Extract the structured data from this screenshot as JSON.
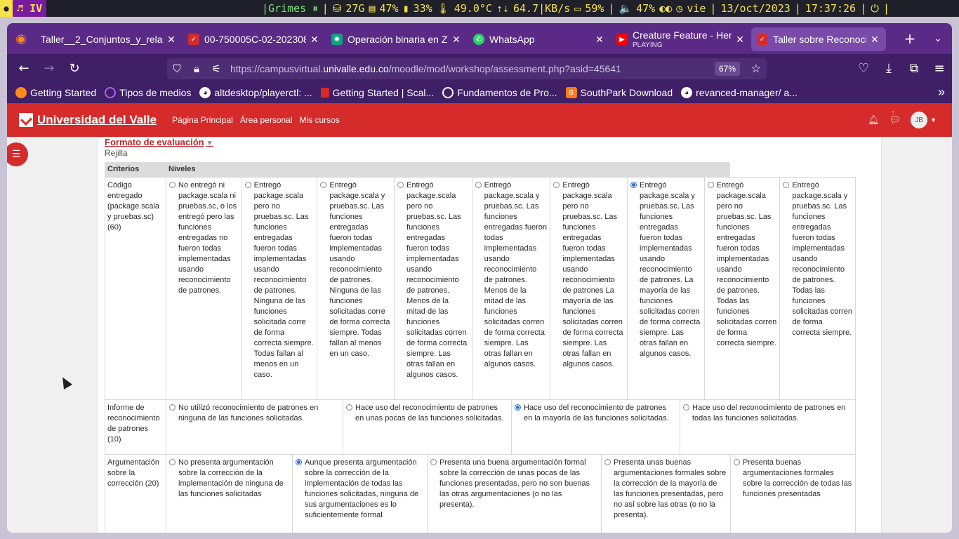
{
  "sysbar": {
    "workspace": "IV",
    "music": "|Grimes ⏸",
    "disk": "27G",
    "mem": "47%",
    "cpu": "33%",
    "temp": "49.0°C",
    "net": "64.7|KB/s",
    "battery": "59%",
    "volume": "47%",
    "day": "vie",
    "date": "13/oct/2023",
    "time": "17:37:26"
  },
  "tabs": [
    {
      "label": "Taller__2_Conjuntos_y_rela",
      "color": "#5b2a86"
    },
    {
      "label": "00-750005C-02-202308",
      "color": "#d52b2b"
    },
    {
      "label": "Operación binaria en Z",
      "color": "#10a37f"
    },
    {
      "label": "WhatsApp",
      "color": "#25d366"
    },
    {
      "label": "Creature Feature - Here",
      "sub": "PLAYING",
      "color": "#ff0000"
    },
    {
      "label": "Taller sobre Reconocim",
      "color": "#d52b2b"
    }
  ],
  "url": {
    "prefix": "https://campusvirtual.",
    "domain": "univalle.edu.co",
    "path": "/moodle/mod/workshop/assessment.php?asid=45641",
    "zoom": "67%"
  },
  "bookmarks": [
    {
      "label": "Getting Started",
      "color": "#ff8a1a"
    },
    {
      "label": "Tipos de medios",
      "color": "#b05cff"
    },
    {
      "label": "altdesktop/playerctl: ...",
      "color": "#ffffff"
    },
    {
      "label": "Getting Started | Scal...",
      "color": "#d52b2b"
    },
    {
      "label": "Fundamentos de Pro...",
      "color": "#ffffff"
    },
    {
      "label": "SouthPark Download",
      "color": "#ff7a1a"
    },
    {
      "label": "revanced-manager/ a...",
      "color": "#ffffff"
    }
  ],
  "site": {
    "name": "Universidad del Valle",
    "nav": [
      "Página Principal",
      "Área personal",
      "Mis cursos"
    ],
    "notif_count": "7",
    "user_initials": "JB"
  },
  "assessment": {
    "section_title": "Formato de evaluación",
    "format": "Rejilla",
    "header_criteria": "Criterios",
    "header_levels": "Niveles"
  },
  "rows": [
    {
      "criterion": "Código entregado (package.scala y pruebas.sc) (60)",
      "levels": [
        {
          "text": "No entregó ni package.scala ni pruebas.sc, o los entregó pero las funciones entregadas no fueron todas implementadas usando reconocimiento de patrones.",
          "selected": false
        },
        {
          "text": "Entregó package.scala pero no pruebas.sc. Las funciones entregadas fueron todas implementadas usando reconocimiento de patrones. Ninguna de las funciones solicitada corre de forma correcta siempre. Todas fallan al menos en un caso.",
          "selected": false
        },
        {
          "text": "Entregó package.scala y pruebas.sc. Las funciones entregadas fueron todas implementadas usando reconocimiento de patrones. Ninguna de las funciones solicitadas corre de forma correcta siempre. Todas fallan al menos en un caso.",
          "selected": false
        },
        {
          "text": "Entregó package.scala pero no pruebas.sc. Las funciones entregadas fueron todas implementadas usando reconocimiento de patrones. Menos de la mitad de las funciones solicitadas corren de forma correcta siempre. Las otras fallan en algunos casos.",
          "selected": false
        },
        {
          "text": "Entregó package.scala y pruebas.sc. Las funciones entregadas fueron todas implementadas usando reconocimiento de patrones. Menos de la mitad de las funciones solicitadas corren de forma correcta siempre. Las otras fallan en algunos casos.",
          "selected": false
        },
        {
          "text": "Entregó package.scala pero no pruebas.sc. Las funciones entregadas fueron todas implementadas usando reconocimiento de patrones La mayoría de las funciones solicitadas corren de forma correcta siempre. Las otras fallan en algunos casos.",
          "selected": false
        },
        {
          "text": "Entregó package.scala y pruebas.sc. Las funciones entregadas fueron todas implementadas usando reconocimiento de patrones. La mayoría de las funciones solicitadas corren de forma correcta siempre. Las otras fallan en algunos casos.",
          "selected": true
        },
        {
          "text": "Entregó package.scala pero no pruebas.sc. Las funciones entregadas fueron todas implementadas usando reconocimiento de patrones. Todas las funciones solicitadas corren de forma correcta siempre.",
          "selected": false
        },
        {
          "text": "Entregó package.scala y pruebas.sc. Las funciones entregadas fueron todas implementadas usando reconocimiento de patrones. Todas las funciones solicitadas corren de forma correcta siempre.",
          "selected": false
        }
      ]
    },
    {
      "criterion": "Informe de reconocimiento de patrones (10)",
      "levels": [
        {
          "text": "No utilizó reconocimiento de patrones en ninguna de las funciones solicitadas.",
          "selected": false
        },
        {
          "text": "Hace uso del reconocimiento de patrones en unas pocas de las funciones solicitadas.",
          "selected": false
        },
        {
          "text": "Hace uso del reconocimiento de patrones en la mayoría de las funciones solicitadas.",
          "selected": true
        },
        {
          "text": "Hace uso del reconocimiento de patrones en todas las funciones solicitadas.",
          "selected": false
        }
      ]
    },
    {
      "criterion": "Argumentación sobre la corrección (20)",
      "levels": [
        {
          "text": "No presenta argumentación sobre la corrección de la implementación de ninguna de las funciones solicitadas",
          "selected": false
        },
        {
          "text": "Aunque presenta argumentación sobre la corrección de la implementación de todas las funciones solicitadas, ninguna de sus argumentaciones es lo suficientemente formal",
          "selected": true
        },
        {
          "text": "Presenta una buena argumentación formal sobre la corrección de unas pocas de las funciones presentadas, pero no son buenas las otras argumentaciones (o no las presenta).",
          "selected": false
        },
        {
          "text": "Presenta unas buenas argumentaciones formales sobre la corrección de la mayoría de las funciones presentadas, pero no así sobre las otras (o no la presenta).",
          "selected": false
        },
        {
          "text": "Presenta buenas argumentaciones formales sobre la corrección de todas las funciones presentadas",
          "selected": false
        }
      ]
    }
  ]
}
